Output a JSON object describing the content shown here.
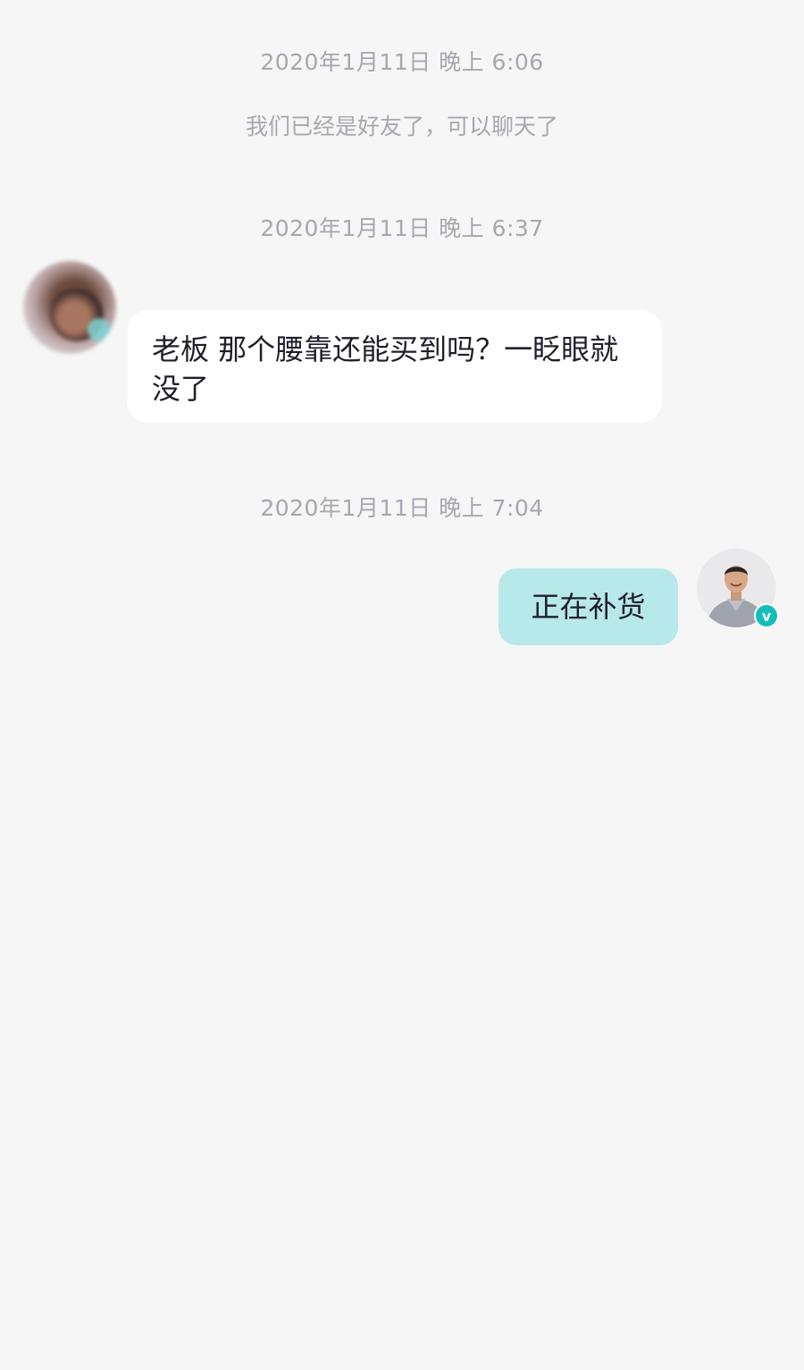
{
  "chat": {
    "timestamps": [
      "2020年1月11日 晚上 6:06",
      "2020年1月11日 晚上 6:37",
      "2020年1月11日 晚上 7:04"
    ],
    "system_note": "我们已经是好友了，可以聊天了",
    "messages": [
      {
        "direction": "incoming",
        "text": "老板 那个腰靠还能买到吗？一眨眼就没了"
      },
      {
        "direction": "outgoing",
        "text": "正在补货"
      }
    ],
    "colors": {
      "background": "#f6f6f6",
      "incoming_bubble": "#ffffff",
      "outgoing_bubble": "#b7e8ea",
      "meta_text": "#a7a7b0",
      "verified_badge": "#11bfb8"
    },
    "icons": {
      "verified_badge": "verified-check-icon",
      "badge_glyph": "v"
    }
  }
}
